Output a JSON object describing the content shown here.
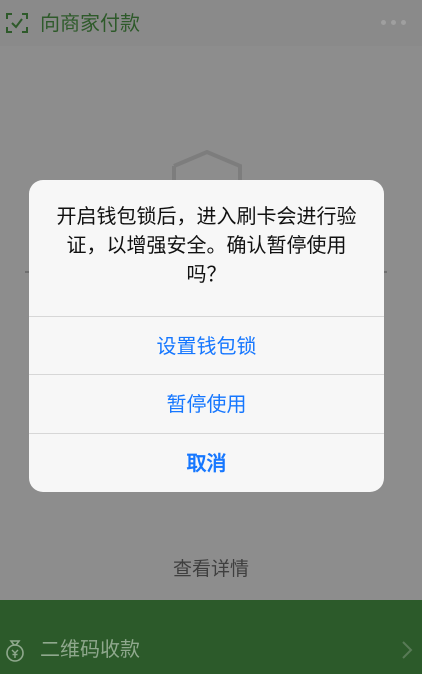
{
  "header": {
    "title": "向商家付款",
    "scan_icon": "scan-icon",
    "more_icon": "more-icon"
  },
  "background": {
    "details_link": "查看详情",
    "shield_icon": "shield-icon"
  },
  "bottom_bar": {
    "label": "二维码收款",
    "icon": "money-bag-icon",
    "chevron": "chevron-right-icon"
  },
  "dialog": {
    "message": "开启钱包锁后，进入刷卡会进行验证，以增强安全。确认暂停使用吗？",
    "buttons": [
      {
        "label": "设置钱包锁"
      },
      {
        "label": "暂停使用"
      },
      {
        "label": "取消"
      }
    ]
  },
  "colors": {
    "accent": "#1677ff",
    "bottom_bar": "#2c5a2a",
    "header_text": "#2e5a2a"
  }
}
